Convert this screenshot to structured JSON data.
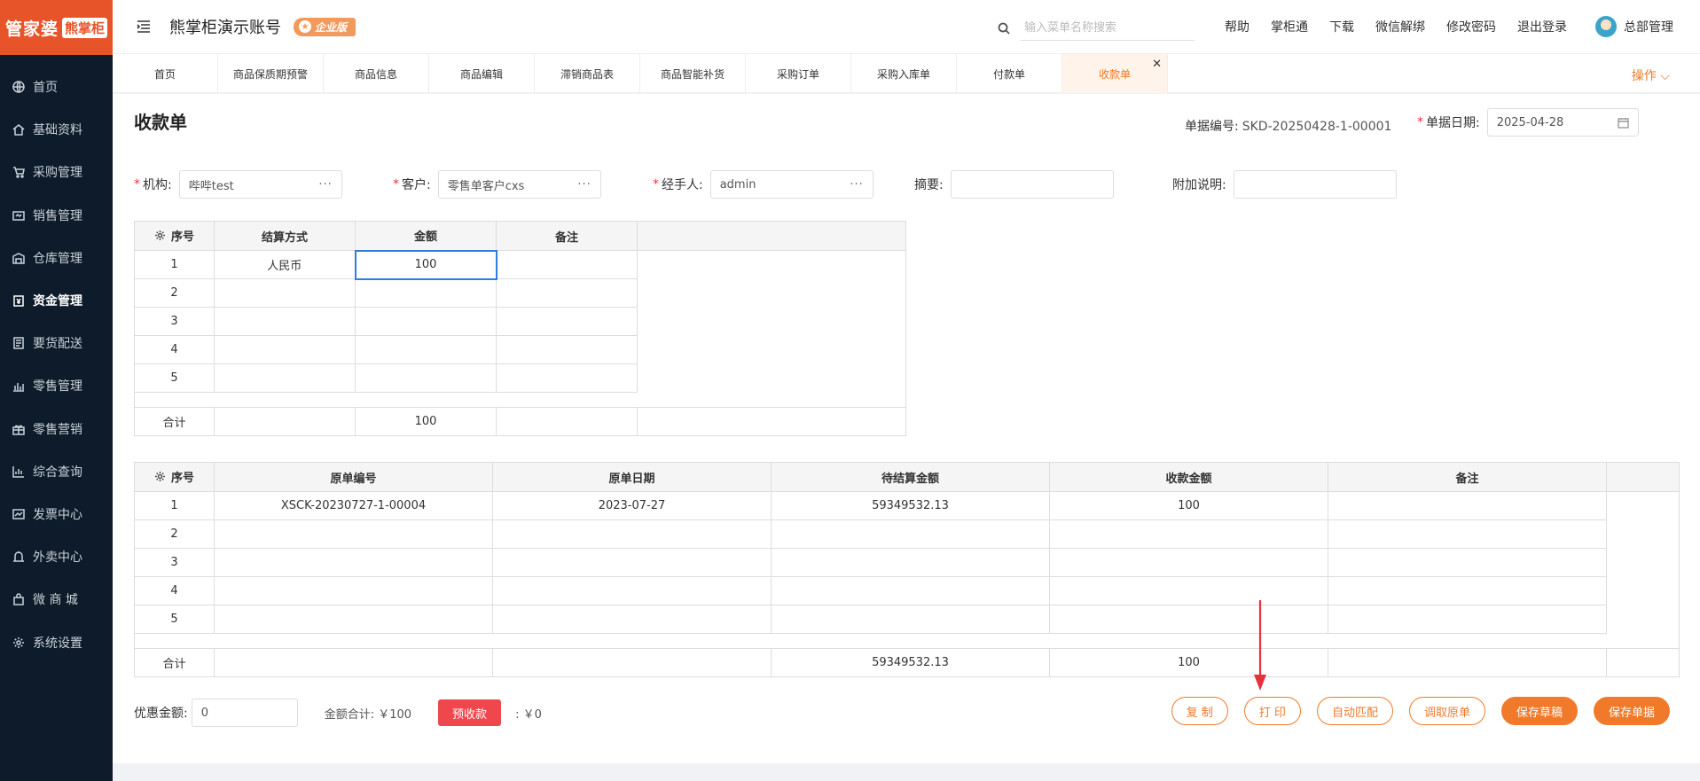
{
  "sidebar": {
    "logo_main": "管家婆",
    "logo_sub": "熊掌柜",
    "items": [
      {
        "label": "首页",
        "icon": "globe-icon"
      },
      {
        "label": "基础资料",
        "icon": "home-icon"
      },
      {
        "label": "采购管理",
        "icon": "cart-icon"
      },
      {
        "label": "销售管理",
        "icon": "sales-icon"
      },
      {
        "label": "仓库管理",
        "icon": "warehouse-icon"
      },
      {
        "label": "资金管理",
        "icon": "fund-icon",
        "active": true
      },
      {
        "label": "要货配送",
        "icon": "delivery-icon"
      },
      {
        "label": "零售管理",
        "icon": "retail-icon"
      },
      {
        "label": "零售营销",
        "icon": "gift-icon"
      },
      {
        "label": "综合查询",
        "icon": "chart-icon"
      },
      {
        "label": "发票中心",
        "icon": "invoice-icon"
      },
      {
        "label": "外卖中心",
        "icon": "takeout-icon"
      },
      {
        "label": "微 商 城",
        "icon": "shop-icon"
      },
      {
        "label": "系统设置",
        "icon": "gear-icon"
      }
    ]
  },
  "header": {
    "account": "熊掌柜演示账号",
    "badge": "企业版",
    "search_placeholder": "输入菜单名称搜索",
    "links": [
      "帮助",
      "掌柜通",
      "下载",
      "微信解绑",
      "修改密码",
      "退出登录"
    ],
    "user": "总部管理"
  },
  "tabs": [
    {
      "label": "首页"
    },
    {
      "label": "商品保质期预警"
    },
    {
      "label": "商品信息"
    },
    {
      "label": "商品编辑"
    },
    {
      "label": "滞销商品表"
    },
    {
      "label": "商品智能补货"
    },
    {
      "label": "采购订单"
    },
    {
      "label": "采购入库单"
    },
    {
      "label": "付款单"
    },
    {
      "label": "收款单",
      "active": true
    }
  ],
  "ops_label": "操作",
  "form": {
    "title": "收款单",
    "docno_label": "单据编号:",
    "docno_value": "SKD-20250428-1-00001",
    "date_label": "单据日期:",
    "date_value": "2025-04-28",
    "org_label": "机构:",
    "org_value": "哔哔test",
    "customer_label": "客户:",
    "customer_value": "零售单客户cxs",
    "handler_label": "经手人:",
    "handler_value": "admin",
    "summary_label": "摘要:",
    "note_label": "附加说明:",
    "dots": "···"
  },
  "settle_table": {
    "headers": [
      "序号",
      "结算方式",
      "金额",
      "备注"
    ],
    "rows": [
      [
        "1",
        "人民币",
        "100",
        ""
      ],
      [
        "2",
        "",
        "",
        ""
      ],
      [
        "3",
        "",
        "",
        ""
      ],
      [
        "4",
        "",
        "",
        ""
      ],
      [
        "5",
        "",
        "",
        ""
      ]
    ],
    "total": [
      "合计",
      "",
      "100",
      ""
    ]
  },
  "source_table": {
    "headers": [
      "序号",
      "原单编号",
      "原单日期",
      "待结算金额",
      "收款金额",
      "备注"
    ],
    "rows": [
      [
        "1",
        "XSCK-20230727-1-00004",
        "2023-07-27",
        "59349532.13",
        "100",
        ""
      ],
      [
        "2",
        "",
        "",
        "",
        "",
        ""
      ],
      [
        "3",
        "",
        "",
        "",
        "",
        ""
      ],
      [
        "4",
        "",
        "",
        "",
        "",
        ""
      ],
      [
        "5",
        "",
        "",
        "",
        "",
        ""
      ]
    ],
    "total": [
      "合计",
      "",
      "",
      "59349532.13",
      "100",
      ""
    ]
  },
  "bottom": {
    "discount_label": "优惠金额:",
    "discount_value": "0",
    "amount_total": "金额合计: ￥100",
    "prepay_btn": "预收款",
    "prepay_value": ": ￥0"
  },
  "buttons": {
    "copy": "复 制",
    "print": "打 印",
    "auto_match": "自动匹配",
    "fetch_source": "调取原单",
    "save_draft": "保存草稿",
    "save_doc": "保存单据"
  },
  "colors": {
    "accent": "#f07a29",
    "logo_bg": "#e8542a",
    "sidebar_bg": "#0d1b2a",
    "prepay": "#f0474c",
    "arrow": "#e8303a"
  }
}
